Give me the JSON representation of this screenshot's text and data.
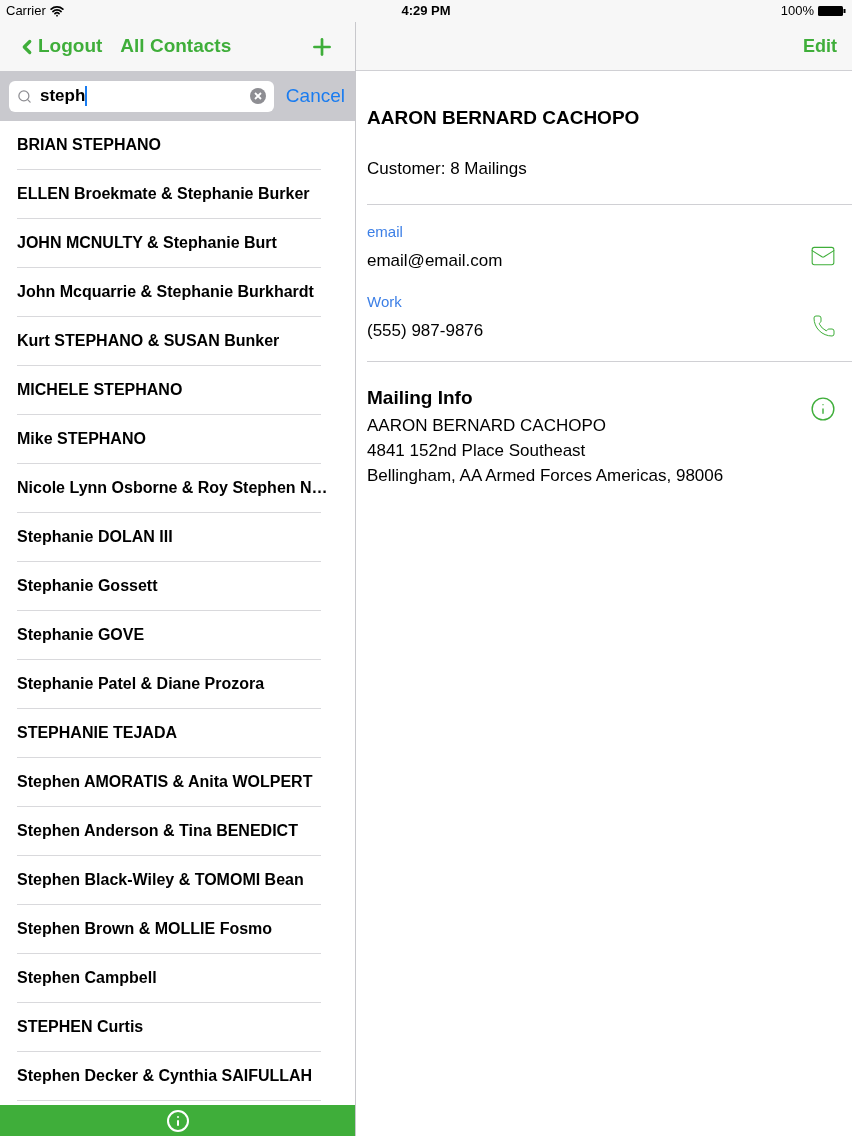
{
  "status_bar": {
    "carrier": "Carrier",
    "time": "4:29 PM",
    "battery": "100%"
  },
  "nav": {
    "back": "Logout",
    "title": "All Contacts"
  },
  "search": {
    "value": "steph",
    "cancel": "Cancel"
  },
  "contacts": [
    {
      "name": "BRIAN STEPHANO"
    },
    {
      "name": "ELLEN Broekmate & Stephanie Burker"
    },
    {
      "name": "JOHN MCNULTY & Stephanie Burt"
    },
    {
      "name": "John Mcquarrie & Stephanie Burkhardt"
    },
    {
      "name": "Kurt STEPHANO & SUSAN Bunker"
    },
    {
      "name": "MICHELE STEPHANO"
    },
    {
      "name": "Mike STEPHANO"
    },
    {
      "name": "Nicole Lynn Osborne & Roy Stephen N…"
    },
    {
      "name": "Stephanie DOLAN III"
    },
    {
      "name": "Stephanie Gossett"
    },
    {
      "name": "Stephanie GOVE"
    },
    {
      "name": "Stephanie Patel & Diane Prozora"
    },
    {
      "name": "STEPHANIE TEJADA"
    },
    {
      "name": "Stephen AMORATIS & Anita WOLPERT"
    },
    {
      "name": "Stephen Anderson & Tina BENEDICT"
    },
    {
      "name": "Stephen Black-Wiley & TOMOMI Bean"
    },
    {
      "name": "Stephen Brown & MOLLIE Fosmo"
    },
    {
      "name": "Stephen Campbell"
    },
    {
      "name": "STEPHEN Curtis"
    },
    {
      "name": "Stephen Decker & Cynthia SAIFULLAH"
    }
  ],
  "detail": {
    "edit": "Edit",
    "name": "AARON BERNARD CACHOPO",
    "subtitle": "Customer: 8 Mailings",
    "fields": [
      {
        "kind": "email",
        "label": "email",
        "value": "email@email.com"
      },
      {
        "kind": "phone",
        "label": "Work",
        "value": "(555) 987-9876"
      }
    ],
    "mailing": {
      "title": "Mailing Info",
      "lines": [
        "AARON BERNARD CACHOPO",
        "4841 152nd Place Southeast",
        "Bellingham, AA Armed Forces Americas, 98006"
      ]
    }
  }
}
